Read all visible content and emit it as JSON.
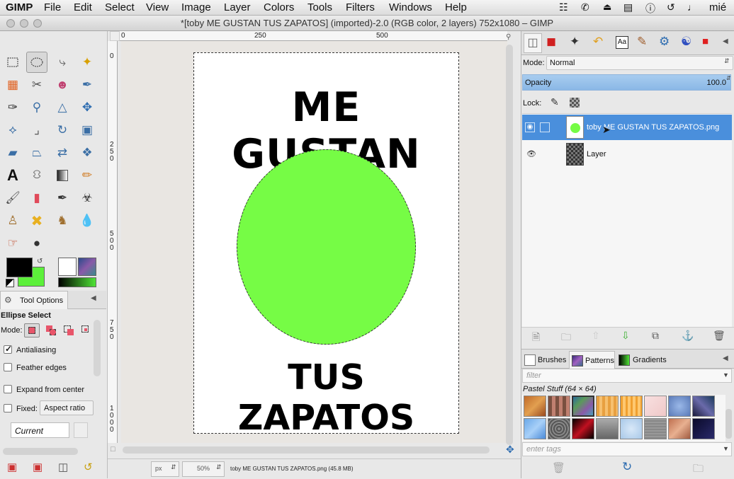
{
  "menubar": {
    "app": "GIMP",
    "items": [
      "File",
      "Edit",
      "Select",
      "View",
      "Image",
      "Layer",
      "Colors",
      "Tools",
      "Filters",
      "Windows",
      "Help"
    ],
    "clock": "mié"
  },
  "window": {
    "title": "*[toby ME GUSTAN TUS ZAPATOS] (imported)-2.0 (RGB color, 2 layers) 752x1080 – GIMP"
  },
  "rulers": {
    "h_ticks": [
      "0",
      "250",
      "500"
    ],
    "v_ticks": [
      "0",
      "2 5 0",
      "5 0 0",
      "7 5 0",
      "1 0 0 0"
    ]
  },
  "canvas": {
    "top_text": "ME GUSTAN",
    "bottom_text": "TUS ZAPATOS",
    "circle_color": "#76fc45"
  },
  "status": {
    "unit": "px",
    "zoom": "50%",
    "info": "toby ME GUSTAN TUS ZAPATOS.png (45.8 MB)"
  },
  "tool_options": {
    "tab_label": "Tool Options",
    "title": "Ellipse Select",
    "mode_label": "Mode:",
    "antialiasing": "Antialiasing",
    "feather": "Feather edges",
    "expand": "Expand from center",
    "fixed": "Fixed:",
    "fixed_value": "Aspect ratio",
    "current": "Current",
    "antialiasing_checked": true
  },
  "layers": {
    "mode_label": "Mode:",
    "mode_value": "Normal",
    "opacity_label": "Opacity",
    "opacity_value": "100.0",
    "lock_label": "Lock:",
    "items": [
      {
        "name": "toby ME GUSTAN TUS ZAPATOS.png",
        "selected": true
      },
      {
        "name": "Layer",
        "selected": false
      }
    ]
  },
  "patterns_panel": {
    "tabs": [
      "Brushes",
      "Patterns",
      "Gradients"
    ],
    "filter_placeholder": "filter",
    "selected_pattern": "Pastel Stuff (64 × 64)",
    "tags_placeholder": "enter tags"
  },
  "colors": {
    "fg": "#000000",
    "bg": "#5cf03a",
    "accent": "#3d8fdc",
    "selected_row": "#4a8fdc"
  }
}
